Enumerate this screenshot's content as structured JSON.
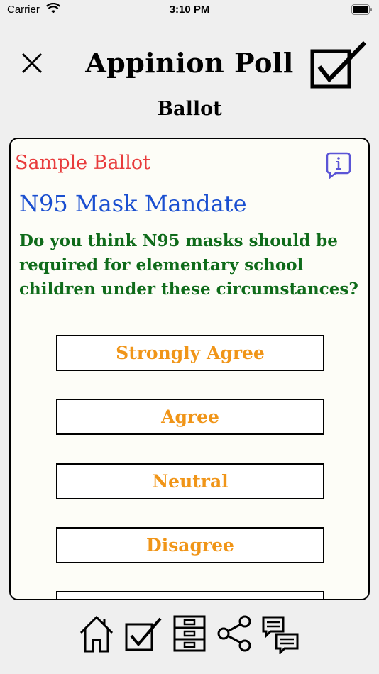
{
  "status_bar": {
    "carrier": "Carrier",
    "time": "3:10 PM"
  },
  "header": {
    "title": "Appinion Poll",
    "subtitle": "Ballot"
  },
  "ballot": {
    "label": "Sample Ballot",
    "title": "N95 Mask Mandate",
    "question": "Do you think N95 masks should be required for elementary school children under these circumstances?",
    "choices": [
      "Strongly Agree",
      "Agree",
      "Neutral",
      "Disagree",
      ""
    ]
  },
  "colors": {
    "sample_label": "#e83b3b",
    "poll_title": "#1a4fd0",
    "question": "#0f6b1a",
    "choice_text": "#f09518",
    "info_icon": "#5b55d6"
  },
  "tab_bar": {
    "icons": [
      "home-icon",
      "ballot-check-icon",
      "file-cabinet-icon",
      "share-icon",
      "chat-bubbles-icon"
    ]
  }
}
